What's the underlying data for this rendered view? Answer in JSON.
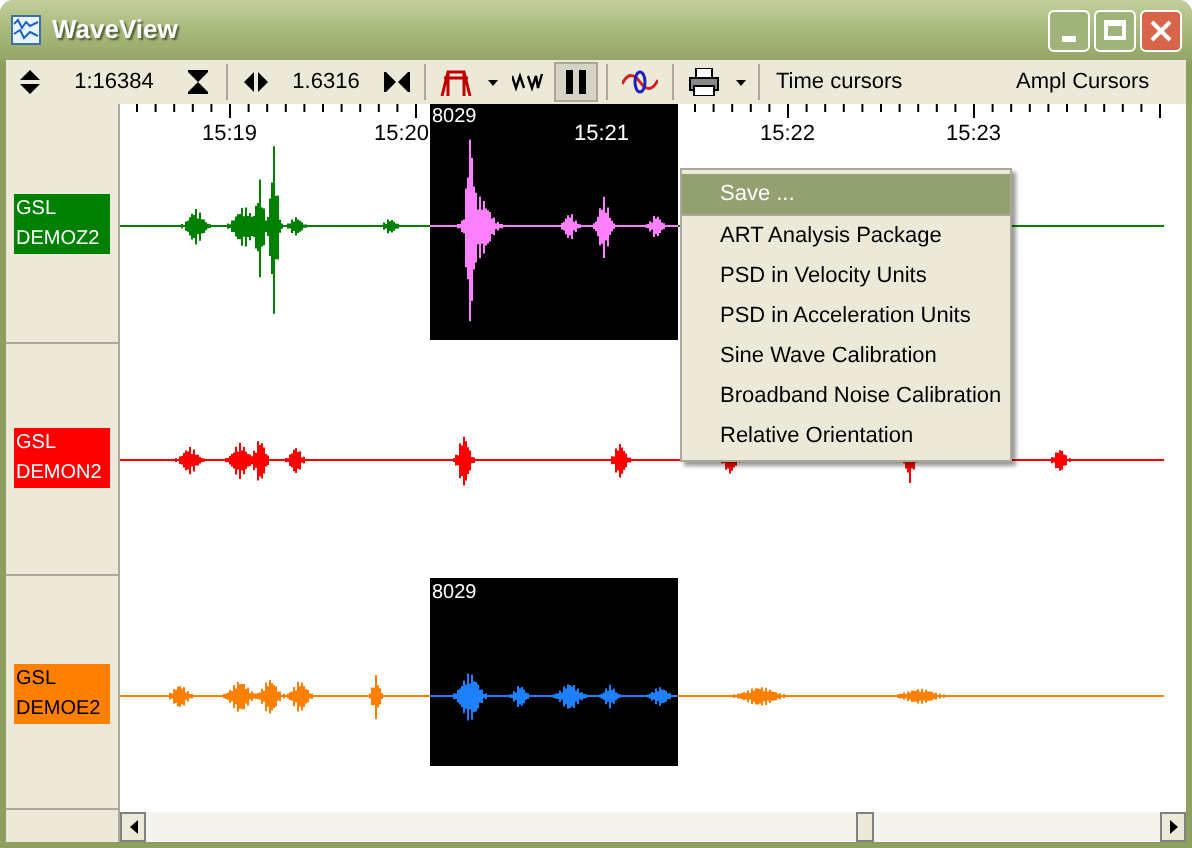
{
  "window": {
    "title": "WaveView"
  },
  "toolbar": {
    "vertical_scale": "1:16384",
    "horizontal_scale": "1.6316",
    "pause_pressed": true,
    "buttons": [
      "Time cursors",
      "Ampl Cursors"
    ]
  },
  "time_axis": {
    "ticks": [
      "15:19",
      "15:20",
      "15:21",
      "15:22",
      "15:23"
    ]
  },
  "channels": [
    {
      "station": "GSL",
      "name": "DEMOZ2",
      "color": "#008000",
      "selection": {
        "label": "8029",
        "color": "#ff80ff"
      }
    },
    {
      "station": "GSL",
      "name": "DEMON2",
      "color": "#ff0000"
    },
    {
      "station": "GSL",
      "name": "DEMOE2",
      "color": "#ff8000",
      "selection": {
        "label": "8029",
        "color": "#1e7fff"
      }
    }
  ],
  "context_menu": {
    "items": [
      {
        "label": "Save ...",
        "selected": true
      },
      {
        "label": "ART Analysis Package",
        "selected": false
      },
      {
        "label": "PSD in Velocity Units",
        "selected": false
      },
      {
        "label": "PSD in Acceleration Units",
        "selected": false
      },
      {
        "label": "Sine Wave Calibration",
        "selected": false
      },
      {
        "label": "Broadband Noise Calibration",
        "selected": false
      },
      {
        "label": "Relative Orientation",
        "selected": false
      }
    ]
  }
}
